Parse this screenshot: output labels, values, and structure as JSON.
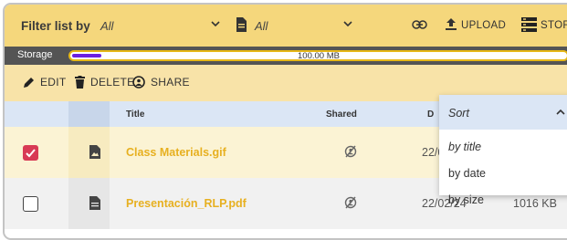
{
  "filter_bar": {
    "label": "Filter list by",
    "select_1_value": "All",
    "select_2_value": "All",
    "upload_label": "UPLOAD",
    "storage_label": "STORAGE"
  },
  "storage_bar": {
    "label": "Storage",
    "capacity_text": "100.00 MB",
    "used_fraction": 0.06,
    "fill_color": "#6b1fe0",
    "border_color": "#e7b818"
  },
  "actions": {
    "edit_label": "EDIT",
    "delete_label": "DELETE",
    "share_label": "SHARE"
  },
  "table": {
    "columns": [
      "Title",
      "Shared",
      "D"
    ],
    "rows": [
      {
        "name": "Class Materials.gif",
        "date": "22/0",
        "size": "",
        "checked": true,
        "file_type": "image-icon"
      },
      {
        "name": "Presentación_RLP.pdf",
        "date": "22/02/24",
        "size": "1016 KB",
        "checked": false,
        "file_type": "document-icon"
      }
    ]
  },
  "sort_menu": {
    "header": "Sort",
    "items": [
      "by title",
      "by date",
      "by size"
    ]
  },
  "colors": {
    "filter_bg": "#f5d77c",
    "action_bg": "#f8e3a8",
    "header_bg": "#dbe6f5",
    "accent_red": "#d83a55",
    "file_name": "#e7b020"
  }
}
